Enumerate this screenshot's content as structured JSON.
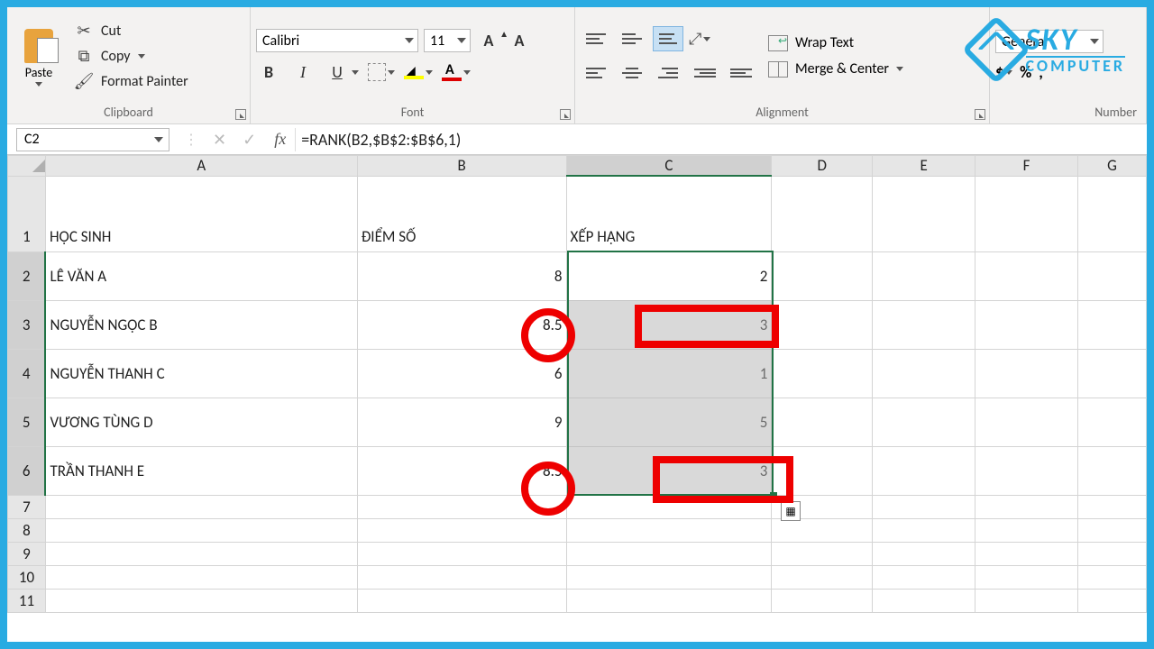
{
  "clipboard": {
    "paste": "Paste",
    "cut": "Cut",
    "copy": "Copy",
    "painter": "Format Painter",
    "group": "Clipboard"
  },
  "font": {
    "name": "Calibri",
    "size": "11",
    "group": "Font"
  },
  "alignment": {
    "wrap": "Wrap Text",
    "merge": "Merge & Center",
    "group": "Alignment"
  },
  "number": {
    "format": "General",
    "group": "Number"
  },
  "logo": {
    "top": "SKY",
    "bottom": "COMPUTER"
  },
  "fbar": {
    "namebox": "C2",
    "formula": "=RANK(B2,$B$2:$B$6,1)"
  },
  "headers": {
    "cols": [
      "A",
      "B",
      "C",
      "D",
      "E",
      "F",
      "G"
    ]
  },
  "rows": {
    "header": {
      "A": "HỌC SINH",
      "B": "ĐIỂM SỐ",
      "C": "XẾP HẠNG"
    },
    "data": [
      {
        "n": "2",
        "A": "LÊ VĂN A",
        "B": "8",
        "C": "2"
      },
      {
        "n": "3",
        "A": "NGUYỄN NGỌC B",
        "B": "8.5",
        "C": "3"
      },
      {
        "n": "4",
        "A": "NGUYỄN THANH C",
        "B": "6",
        "C": "1"
      },
      {
        "n": "5",
        "A": "VƯƠNG TÙNG D",
        "B": "9",
        "C": "5"
      },
      {
        "n": "6",
        "A": "TRẦN THANH E",
        "B": "8.5",
        "C": "3"
      }
    ],
    "blank": [
      "7",
      "8",
      "9",
      "10",
      "11"
    ]
  }
}
